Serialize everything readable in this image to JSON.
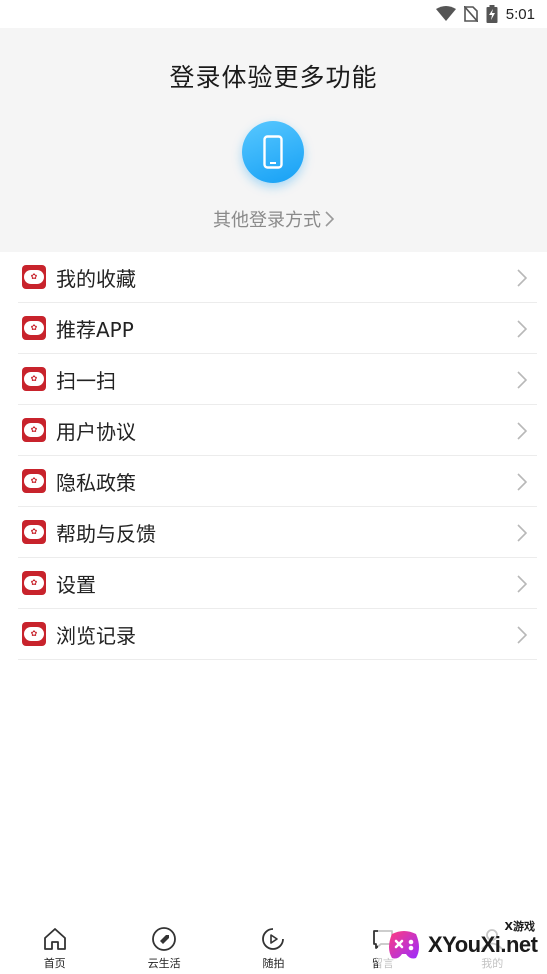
{
  "status_bar": {
    "time": "5:01",
    "icons": [
      "wifi-icon",
      "no-sim-icon",
      "battery-charging-icon"
    ]
  },
  "login": {
    "title": "登录体验更多功能",
    "phone_icon": "phone-icon",
    "accent_color": "#16a0f5",
    "other_login_label": "其他登录方式"
  },
  "menu": {
    "items": [
      {
        "label": "我的收藏",
        "icon": "brand-logo-icon"
      },
      {
        "label": "推荐APP",
        "icon": "brand-logo-icon"
      },
      {
        "label": "扫一扫",
        "icon": "brand-logo-icon"
      },
      {
        "label": "用户协议",
        "icon": "brand-logo-icon"
      },
      {
        "label": "隐私政策",
        "icon": "brand-logo-icon"
      },
      {
        "label": "帮助与反馈",
        "icon": "brand-logo-icon"
      },
      {
        "label": "设置",
        "icon": "brand-logo-icon"
      },
      {
        "label": "浏览记录",
        "icon": "brand-logo-icon"
      }
    ],
    "icon_color": "#c8232c"
  },
  "bottom_nav": {
    "items": [
      {
        "label": "首页",
        "icon": "home-icon"
      },
      {
        "label": "云生活",
        "icon": "tag-icon"
      },
      {
        "label": "随拍",
        "icon": "video-play-icon"
      },
      {
        "label": "留言",
        "icon": "message-icon"
      },
      {
        "label": "我的",
        "icon": "user-icon"
      }
    ]
  },
  "watermark": {
    "brand": "XYouXi.net",
    "sub": "X游戏"
  }
}
